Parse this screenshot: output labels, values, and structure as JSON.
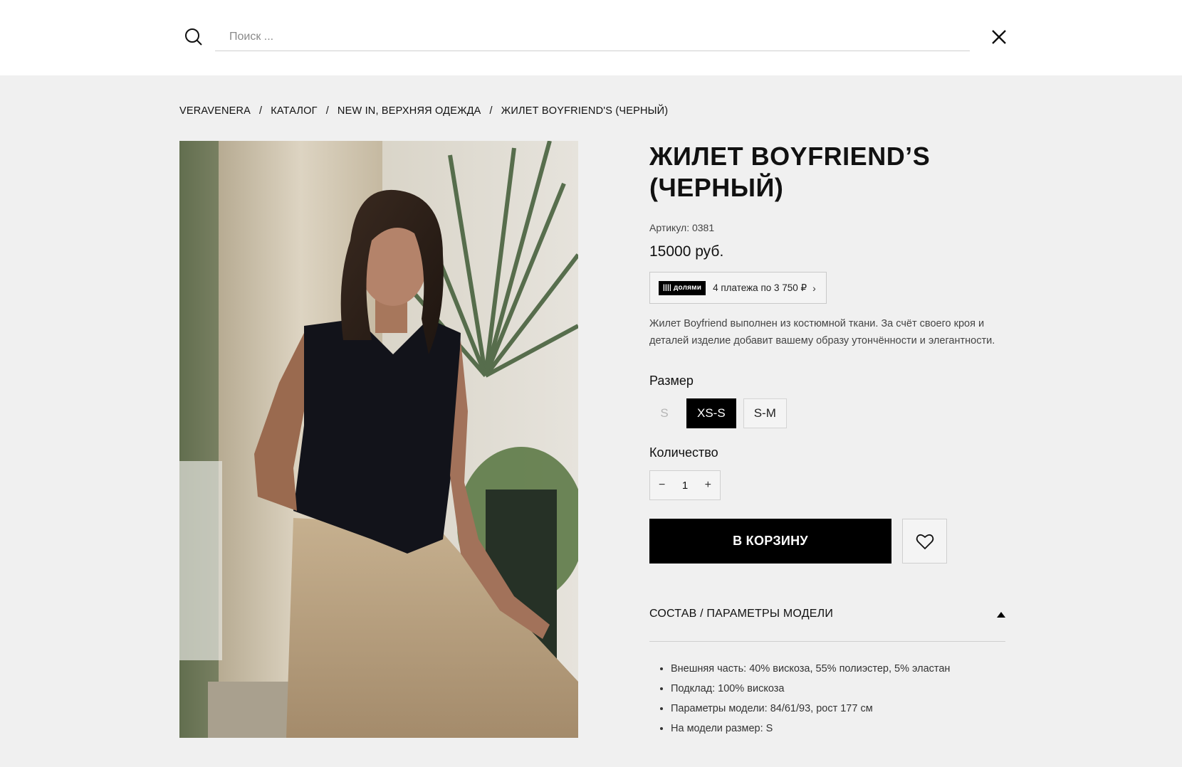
{
  "search": {
    "placeholder": "Поиск ..."
  },
  "breadcrumb": [
    "VERAVENERA",
    "КАТАЛОГ",
    "NEW IN, ВЕРХНЯЯ ОДЕЖДА",
    "ЖИЛЕТ BOYFRIEND'S (ЧЕРНЫЙ)"
  ],
  "breadcrumb_sep": "/",
  "product": {
    "title_line1": "ЖИЛЕТ BOYFRIEND’S",
    "title_line2": "(ЧЕРНЫЙ)",
    "sku": "Артикул: 0381",
    "price": "15000 руб.",
    "dolyami": {
      "logo": "|||| долями",
      "text": "4 платежа по 3 750 ₽",
      "arrow": "›"
    },
    "description": "Жилет Boyfriend выполнен из костюмной ткани. За счёт своего кроя и деталей изделие добавит вашему образу утончённости и элегантности.",
    "size_label": "Размер",
    "sizes": [
      {
        "label": "S",
        "state": "disabled"
      },
      {
        "label": "XS-S",
        "state": "selected"
      },
      {
        "label": "S-M",
        "state": "available"
      }
    ],
    "quantity_label": "Количество",
    "quantity": {
      "minus": "−",
      "value": "1",
      "plus": "+"
    },
    "add_to_cart": "В КОРЗИНУ",
    "accordion_title": "СОСТАВ / ПАРАМЕТРЫ МОДЕЛИ",
    "specs": [
      "Внешняя часть: 40% вискоза, 55% полиэстер, 5% эластан",
      "Подклад: 100% вискоза",
      "Параметры модели: 84/61/93, рост 177 см",
      "На модели размер: S"
    ]
  },
  "colors": {
    "accent": "#000000",
    "page_bg": "#f0f0f0",
    "header_bg": "#ffffff"
  }
}
